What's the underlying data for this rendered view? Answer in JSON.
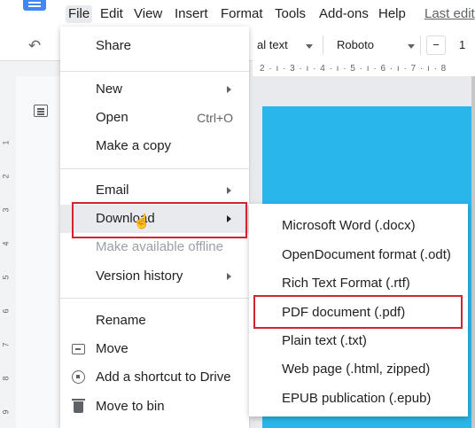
{
  "menubar": {
    "items": [
      "File",
      "Edit",
      "View",
      "Insert",
      "Format",
      "Tools",
      "Add-ons",
      "Help"
    ],
    "last_edit": "Last edit"
  },
  "toolbar": {
    "style": "al text",
    "font": "Roboto",
    "minus": "−",
    "font_size": "1"
  },
  "ruler": "2 · ı · 3 · ı · 4 · ı · 5 · ı · 6 · ı · 7 · ı · 8",
  "left_ruler": [
    "1",
    "2",
    "3",
    "4",
    "5",
    "6",
    "7",
    "8",
    "9"
  ],
  "file_menu": {
    "share": "Share",
    "new": "New",
    "open": "Open",
    "open_shortcut": "Ctrl+O",
    "make_copy": "Make a copy",
    "email": "Email",
    "download": "Download",
    "offline": "Make available offline",
    "version_history": "Version history",
    "rename": "Rename",
    "move": "Move",
    "add_shortcut": "Add a shortcut to Drive",
    "move_to_bin": "Move to bin"
  },
  "download_submenu": {
    "items": [
      "Microsoft Word (.docx)",
      "OpenDocument format (.odt)",
      "Rich Text Format (.rtf)",
      "PDF document (.pdf)",
      "Plain text (.txt)",
      "Web page (.html, zipped)",
      "EPUB publication (.epub)"
    ]
  },
  "colors": {
    "highlight": "#d3232f",
    "page": "#29b6e8",
    "logo": "#4285f4"
  }
}
